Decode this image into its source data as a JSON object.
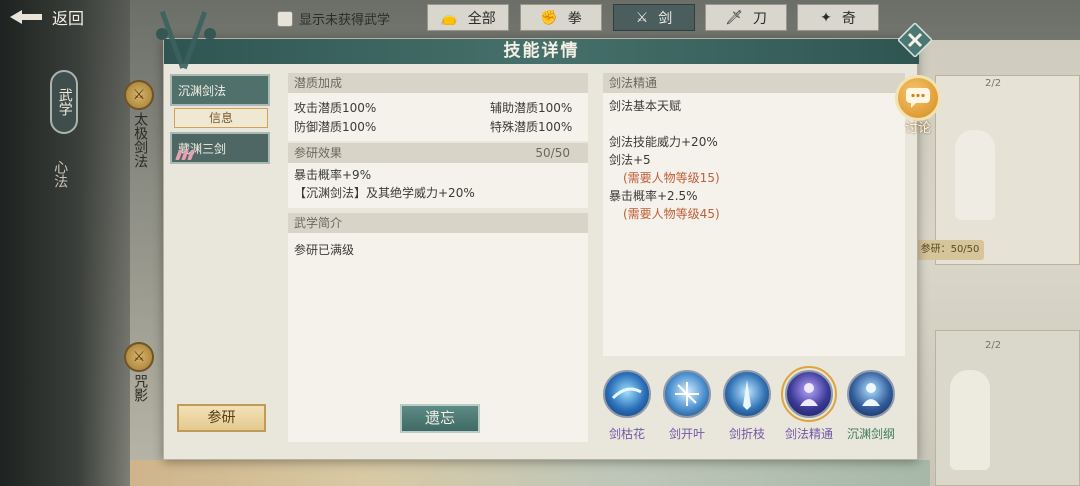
{
  "topbar": {
    "back_label": "返回",
    "show_unowned_label": "显示未获得武学",
    "tabs": [
      {
        "label": "全部",
        "icon": "bag-icon"
      },
      {
        "label": "拳",
        "icon": "fist-icon"
      },
      {
        "label": "剑",
        "icon": "sword-icon",
        "active": true
      },
      {
        "label": "刀",
        "icon": "blade-icon"
      },
      {
        "label": "奇",
        "icon": "shuriken-icon"
      }
    ]
  },
  "left_nav": {
    "wushu_label": "武学",
    "xinfa_label": "心法"
  },
  "background": {
    "title_1": "太极剑法",
    "title_2": "咒影",
    "badge_1": "2/2",
    "badge_2": "2/2",
    "research_text": "参研：50/50"
  },
  "modal": {
    "title": "技能详情",
    "list": {
      "item_1": "沉渊剑法",
      "info_label": "信息",
      "item_2": "藏渊三剑"
    },
    "research_button": "参研",
    "forget_button": "遗忘",
    "potential": {
      "title": "潜质加成",
      "attack": "攻击潜质100%",
      "assist": "辅助潜质100%",
      "defense": "防御潜质100%",
      "special": "特殊潜质100%"
    },
    "research": {
      "title": "参研效果",
      "progress": "50/50",
      "line_1": "暴击概率+9%",
      "line_2": "【沉渊剑法】及其绝学威力+20%"
    },
    "intro": {
      "title": "武学简介",
      "text": "参研已满级"
    },
    "mastery": {
      "title": "剑法精通",
      "base": "剑法基本天赋",
      "line_1": "剑法技能威力+20%",
      "line_2": "剑法+5",
      "req_1": "(需要人物等级15)",
      "line_3": "暴击概率+2.5%",
      "req_2": "(需要人物等级45)"
    },
    "skills": [
      {
        "label": "剑枯花"
      },
      {
        "label": "剑开叶"
      },
      {
        "label": "剑折枝"
      },
      {
        "label": "剑法精通",
        "selected": true
      },
      {
        "label": "沉渊剑纲"
      }
    ],
    "discuss_label": "讨论"
  }
}
